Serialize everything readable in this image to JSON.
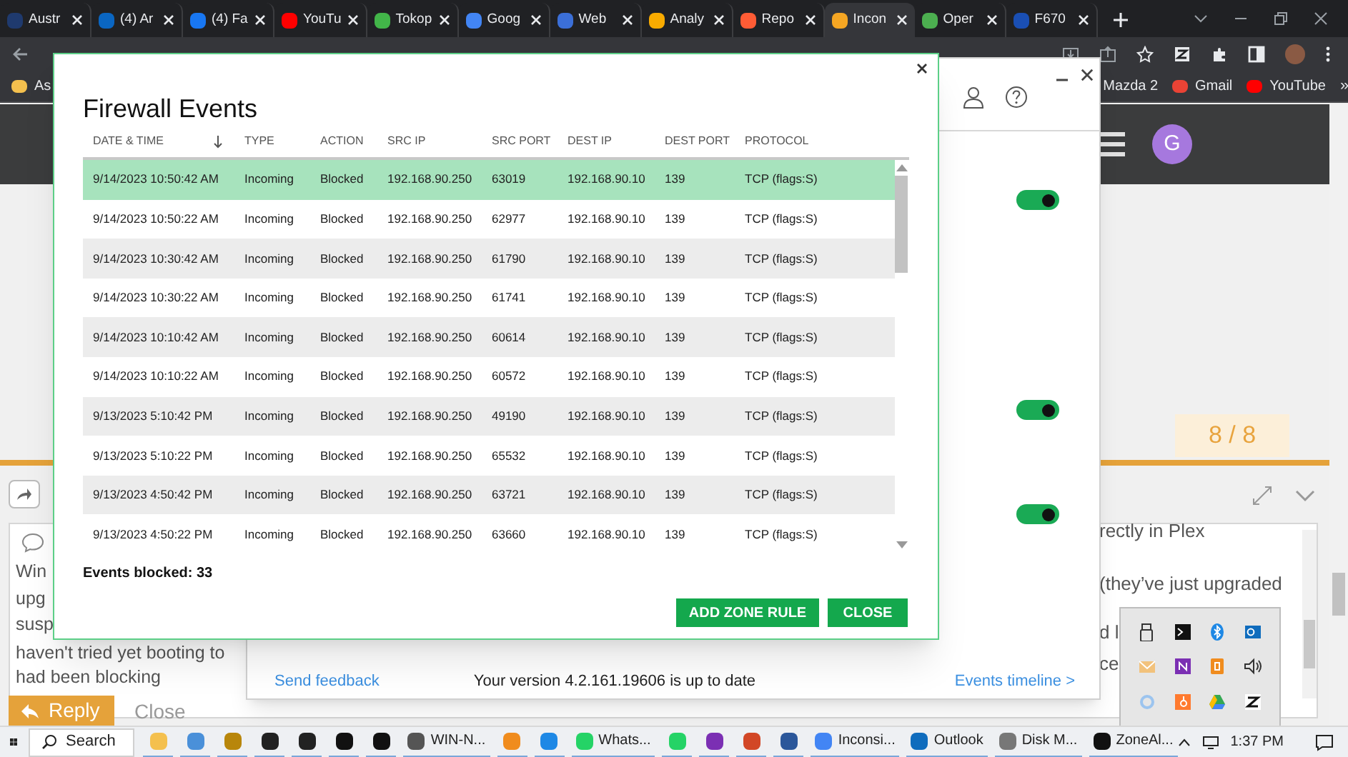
{
  "browser": {
    "tabs": [
      {
        "title": "Austr",
        "color": "#1f3a6e",
        "selected": false
      },
      {
        "title": "(4) Ar",
        "color": "#0a66c2",
        "selected": false
      },
      {
        "title": "(4) Fa",
        "color": "#1877f2",
        "selected": false
      },
      {
        "title": "YouTu",
        "color": "#ff0000",
        "selected": false
      },
      {
        "title": "Tokop",
        "color": "#42b549",
        "selected": false
      },
      {
        "title": "Goog",
        "color": "#4285f4",
        "selected": false
      },
      {
        "title": "Web",
        "color": "#3b6fd8",
        "selected": false
      },
      {
        "title": "Analy",
        "color": "#f9ab00",
        "selected": false
      },
      {
        "title": "Repo",
        "color": "#ff5c35",
        "selected": false
      },
      {
        "title": "Incon",
        "color": "#f5a623",
        "selected": true
      },
      {
        "title": "Oper",
        "color": "#4caf50",
        "selected": false
      },
      {
        "title": "F670",
        "color": "#1a4fb4",
        "selected": false
      }
    ],
    "bookmarks": [
      {
        "label": "As",
        "color": "#f4c04e"
      },
      {
        "label": "Mazda 2"
      },
      {
        "label": "Gmail",
        "color": "#ea4335"
      },
      {
        "label": "YouTube",
        "color": "#ff0000"
      }
    ],
    "more_bookmarks": "»"
  },
  "forum": {
    "avatar": "G",
    "counter": "8 / 8",
    "left_lines": [
      "Win",
      "upg",
      "susp",
      "haven't tried yet booting to",
      "had been blocking"
    ],
    "right_lines": [
      "rectly in Plex",
      "(they’ve just upgraded",
      "d l",
      "ce"
    ],
    "reply_button": "Reply",
    "close_link": "Close"
  },
  "zonealarm": {
    "toggles": [
      {
        "on": true
      },
      {
        "on": true
      },
      {
        "on": true
      }
    ],
    "feedback": "Send feedback",
    "version": "Your version 4.2.161.19606 is up to date",
    "timeline": "Events timeline >"
  },
  "firewall_events": {
    "title": "Firewall Events",
    "columns": [
      "DATE & TIME",
      "TYPE",
      "ACTION",
      "SRC IP",
      "SRC PORT",
      "DEST IP",
      "DEST PORT",
      "PROTOCOL"
    ],
    "rows": [
      {
        "cells": [
          "9/14/2023 10:50:42 AM",
          "Incoming",
          "Blocked",
          "192.168.90.250",
          "63019",
          "192.168.90.10",
          "139",
          "TCP (flags:S)"
        ],
        "selected": true
      },
      {
        "cells": [
          "9/14/2023 10:50:22 AM",
          "Incoming",
          "Blocked",
          "192.168.90.250",
          "62977",
          "192.168.90.10",
          "139",
          "TCP (flags:S)"
        ],
        "selected": false
      },
      {
        "cells": [
          "9/14/2023 10:30:42 AM",
          "Incoming",
          "Blocked",
          "192.168.90.250",
          "61790",
          "192.168.90.10",
          "139",
          "TCP (flags:S)"
        ],
        "selected": false
      },
      {
        "cells": [
          "9/14/2023 10:30:22 AM",
          "Incoming",
          "Blocked",
          "192.168.90.250",
          "61741",
          "192.168.90.10",
          "139",
          "TCP (flags:S)"
        ],
        "selected": false
      },
      {
        "cells": [
          "9/14/2023 10:10:42 AM",
          "Incoming",
          "Blocked",
          "192.168.90.250",
          "60614",
          "192.168.90.10",
          "139",
          "TCP (flags:S)"
        ],
        "selected": false
      },
      {
        "cells": [
          "9/14/2023 10:10:22 AM",
          "Incoming",
          "Blocked",
          "192.168.90.250",
          "60572",
          "192.168.90.10",
          "139",
          "TCP (flags:S)"
        ],
        "selected": false
      },
      {
        "cells": [
          "9/13/2023 5:10:42 PM",
          "Incoming",
          "Blocked",
          "192.168.90.250",
          "49190",
          "192.168.90.10",
          "139",
          "TCP (flags:S)"
        ],
        "selected": false
      },
      {
        "cells": [
          "9/13/2023 5:10:22 PM",
          "Incoming",
          "Blocked",
          "192.168.90.250",
          "65532",
          "192.168.90.10",
          "139",
          "TCP (flags:S)"
        ],
        "selected": false
      },
      {
        "cells": [
          "9/13/2023 4:50:42 PM",
          "Incoming",
          "Blocked",
          "192.168.90.250",
          "63721",
          "192.168.90.10",
          "139",
          "TCP (flags:S)"
        ],
        "selected": false
      },
      {
        "cells": [
          "9/13/2023 4:50:22 PM",
          "Incoming",
          "Blocked",
          "192.168.90.250",
          "63660",
          "192.168.90.10",
          "139",
          "TCP (flags:S)"
        ],
        "selected": false
      }
    ],
    "summary": "Events blocked: 33",
    "buttons": [
      "ADD ZONE RULE",
      "CLOSE"
    ]
  },
  "taskbar": {
    "search": "Search",
    "apps": [
      {
        "label": "WIN-N..."
      },
      {
        "label": "Whats..."
      },
      {
        "label": "Inconsi..."
      },
      {
        "label": "Outlook"
      },
      {
        "label": "Disk M..."
      },
      {
        "label": "ZoneAl..."
      }
    ],
    "time": "1:37 PM"
  }
}
